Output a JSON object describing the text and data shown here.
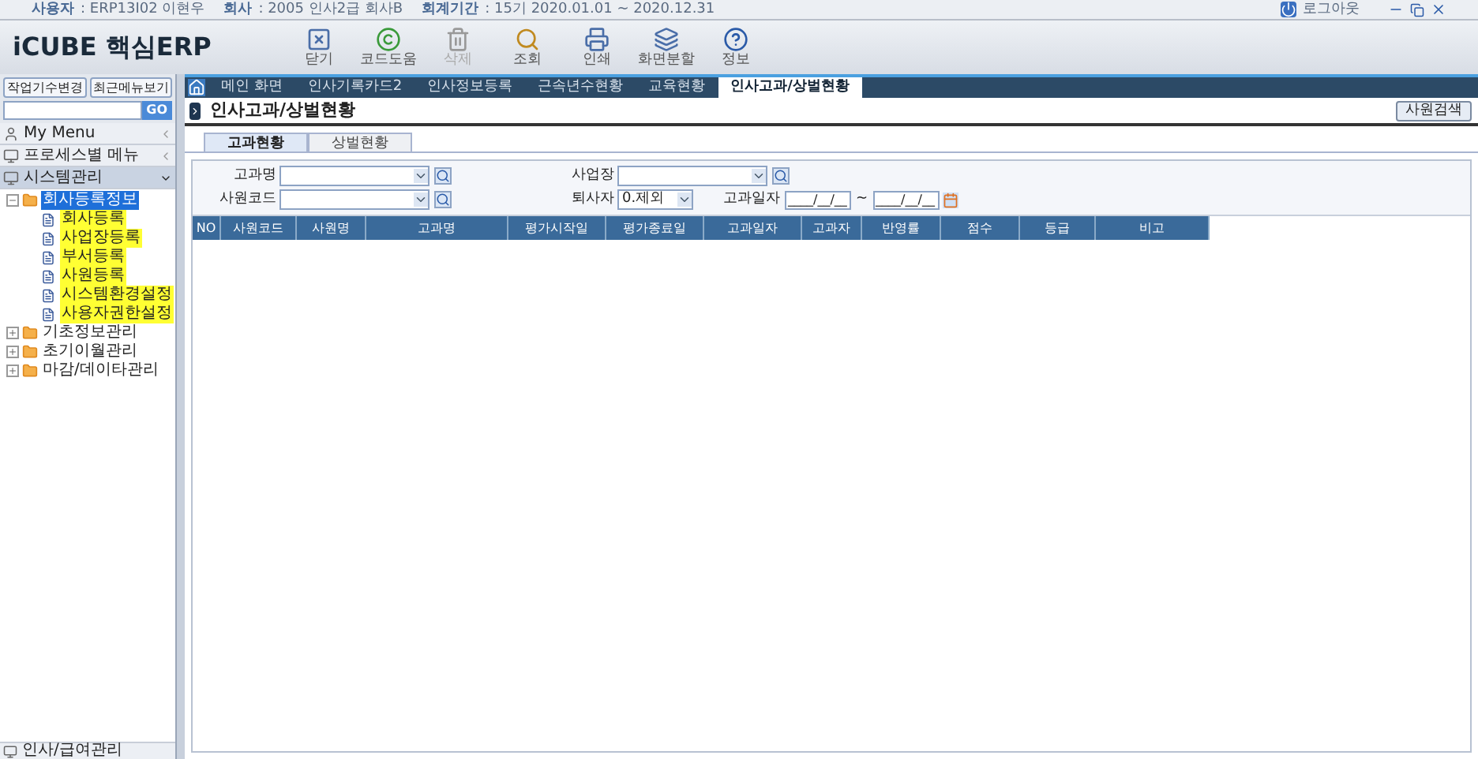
{
  "info_bar": {
    "user_label": "사용자",
    "user": ": ERP13I02 이현우",
    "company_label": "회사",
    "company": ": 2005 인사2급 회사B",
    "period_label": "회계기간",
    "period": ": 15기 2020.01.01 ~ 2020.12.31",
    "logout": "로그아웃"
  },
  "logo": "iCUBE 핵심ERP",
  "toolbar": [
    {
      "label": "닫기",
      "disabled": false
    },
    {
      "label": "코드도움",
      "disabled": false
    },
    {
      "label": "삭제",
      "disabled": true
    },
    {
      "label": "조회",
      "disabled": false
    },
    {
      "label": "인쇄",
      "disabled": false
    },
    {
      "label": "화면분할",
      "disabled": false
    },
    {
      "label": "정보",
      "disabled": false
    }
  ],
  "sidebar": {
    "buttons": [
      "작업기수변경",
      "최근메뉴보기"
    ],
    "search_button": "GO",
    "sections": [
      {
        "label": "My Menu",
        "expanded": false
      },
      {
        "label": "프로세스별 메뉴",
        "expanded": false
      },
      {
        "label": "시스템관리",
        "expanded": true
      }
    ],
    "tree": [
      {
        "label": "회사등록정보",
        "selected": true,
        "highlighted": false,
        "expanded": true,
        "children": [
          {
            "label": "회사등록",
            "selected": false,
            "highlighted": true
          },
          {
            "label": "사업장등록",
            "selected": false,
            "highlighted": true
          },
          {
            "label": "부서등록",
            "selected": false,
            "highlighted": true
          },
          {
            "label": "사원등록",
            "selected": false,
            "highlighted": true
          },
          {
            "label": "시스템환경설정",
            "selected": false,
            "highlighted": true
          },
          {
            "label": "사용자권한설정",
            "selected": false,
            "highlighted": true
          }
        ]
      },
      {
        "label": "기초정보관리",
        "selected": false,
        "highlighted": false,
        "expanded": false
      },
      {
        "label": "초기이월관리",
        "selected": false,
        "highlighted": false,
        "expanded": false
      },
      {
        "label": "마감/데이타관리",
        "selected": false,
        "highlighted": false,
        "expanded": false
      }
    ],
    "bottom_section": "인사/급여관리"
  },
  "tabs": [
    {
      "label": "메인 화면",
      "selected": false
    },
    {
      "label": "인사기록카드2",
      "selected": false
    },
    {
      "label": "인사정보등록",
      "selected": false
    },
    {
      "label": "근속년수현황",
      "selected": false
    },
    {
      "label": "교육현황",
      "selected": false
    },
    {
      "label": "인사고과/상벌현황",
      "selected": true
    }
  ],
  "page_title": "인사고과/상벌현황",
  "employee_search_button": "사원검색",
  "sub_tabs": [
    {
      "label": "고과현황",
      "selected": true
    },
    {
      "label": "상벌현황",
      "selected": false
    }
  ],
  "filters": {
    "course": {
      "label": "고과명"
    },
    "site": {
      "label": "사업장"
    },
    "employee_code": {
      "label": "사원코드"
    },
    "retired": {
      "label": "퇴사자",
      "value": "0.제외"
    },
    "date": {
      "label": "고과일자",
      "from": "____/__/__",
      "separator": "~",
      "to": "____/__/__"
    }
  },
  "table": {
    "columns": [
      "NO",
      "사원코드",
      "사원명",
      "고과명",
      "평가시작일",
      "평가종료일",
      "고과일자",
      "고과자",
      "반영률",
      "점수",
      "등급",
      "비고"
    ]
  }
}
